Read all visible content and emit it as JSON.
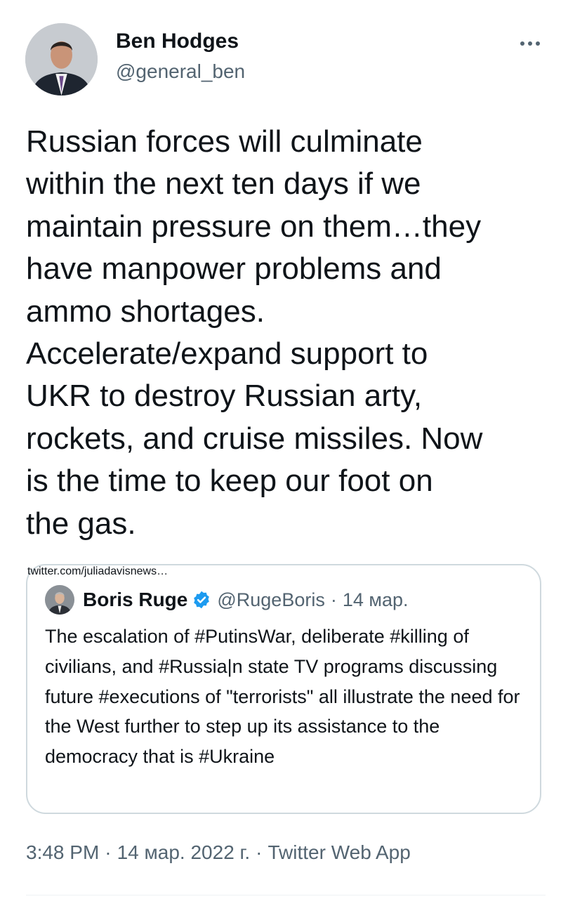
{
  "author": {
    "name": "Ben Hodges",
    "handle": "@general_ben"
  },
  "more_icon": "more-horizontal-icon",
  "tweet": {
    "text": "Russian forces will culminate\nwithin the next ten days if we\nmaintain pressure on them…they\nhave manpower problems and\nammo shortages.\nAccelerate/expand support to\nUKR to destroy Russian arty,\nrockets, and cruise missiles. Now\nis the time to keep our foot on\nthe gas."
  },
  "quoted": {
    "name": "Boris Ruge",
    "verified_icon": "verified-badge-icon",
    "handle": "@RugeBoris",
    "separator": "·",
    "date": "14 мар.",
    "text": "The escalation of #PutinsWar, deliberate #killing of civilians, and #Russia|n state TV programs discussing future #executions of \"terrorists\" all illustrate the need for the West further to step up its assistance to the democracy that is #Ukraine",
    "flag_icon": "ukraine-flag-icon",
    "link": "twitter.com/juliadavisnews…"
  },
  "meta": {
    "time": "3:48 PM",
    "sep1": "·",
    "date": "14 мар. 2022 г.",
    "sep2": "·",
    "source": "Twitter Web App"
  },
  "colors": {
    "text": "#0f1419",
    "secondary": "#536471",
    "border": "#cfd9de",
    "verified": "#1d9bf0",
    "flag_blue": "#0057b7",
    "flag_yellow": "#ffd700"
  }
}
